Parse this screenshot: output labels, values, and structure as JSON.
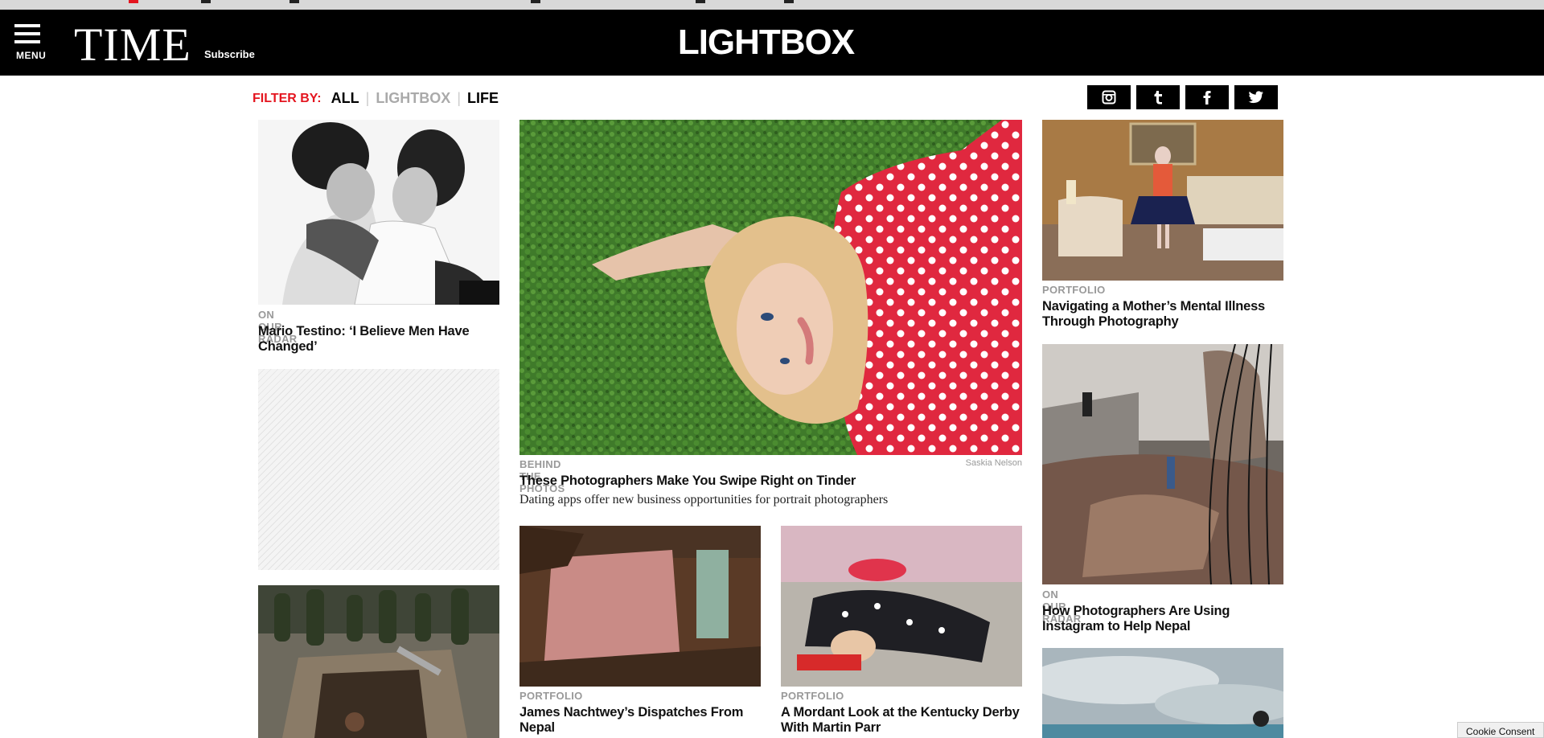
{
  "header": {
    "menu_label": "MENU",
    "logo": "TIME",
    "subscribe": "Subscribe",
    "section_title": "LIGHTBOX"
  },
  "filter": {
    "label": "FILTER BY:",
    "options": [
      "ALL",
      "LIGHTBOX",
      "LIFE"
    ]
  },
  "social": [
    "instagram-icon",
    "tumblr-icon",
    "facebook-icon",
    "twitter-icon"
  ],
  "articles": [
    {
      "kicker": "ON OUR RADAR",
      "title": "Mario Testino: ‘I Believe Men Have Changed’"
    },
    {
      "kicker": "BEHIND THE PHOTOS",
      "title": "These Photographers Make You Swipe Right on Tinder",
      "dek": "Dating apps offer new business opportunities for portrait photographers",
      "credit": "Saskia Nelson"
    },
    {
      "kicker": "PORTFOLIO",
      "title": "Navigating a Mother’s Mental Illness Through Photography"
    },
    {
      "kicker": "ON OUR RADAR",
      "title": "How Photographers Are Using Instagram to Help Nepal"
    },
    {
      "kicker": "PORTFOLIO",
      "title": "James Nachtwey’s Dispatches From Nepal"
    },
    {
      "kicker": "PORTFOLIO",
      "title": "A Mordant Look at the Kentucky Derby With Martin Parr"
    }
  ],
  "cookie": "Cookie Consent"
}
